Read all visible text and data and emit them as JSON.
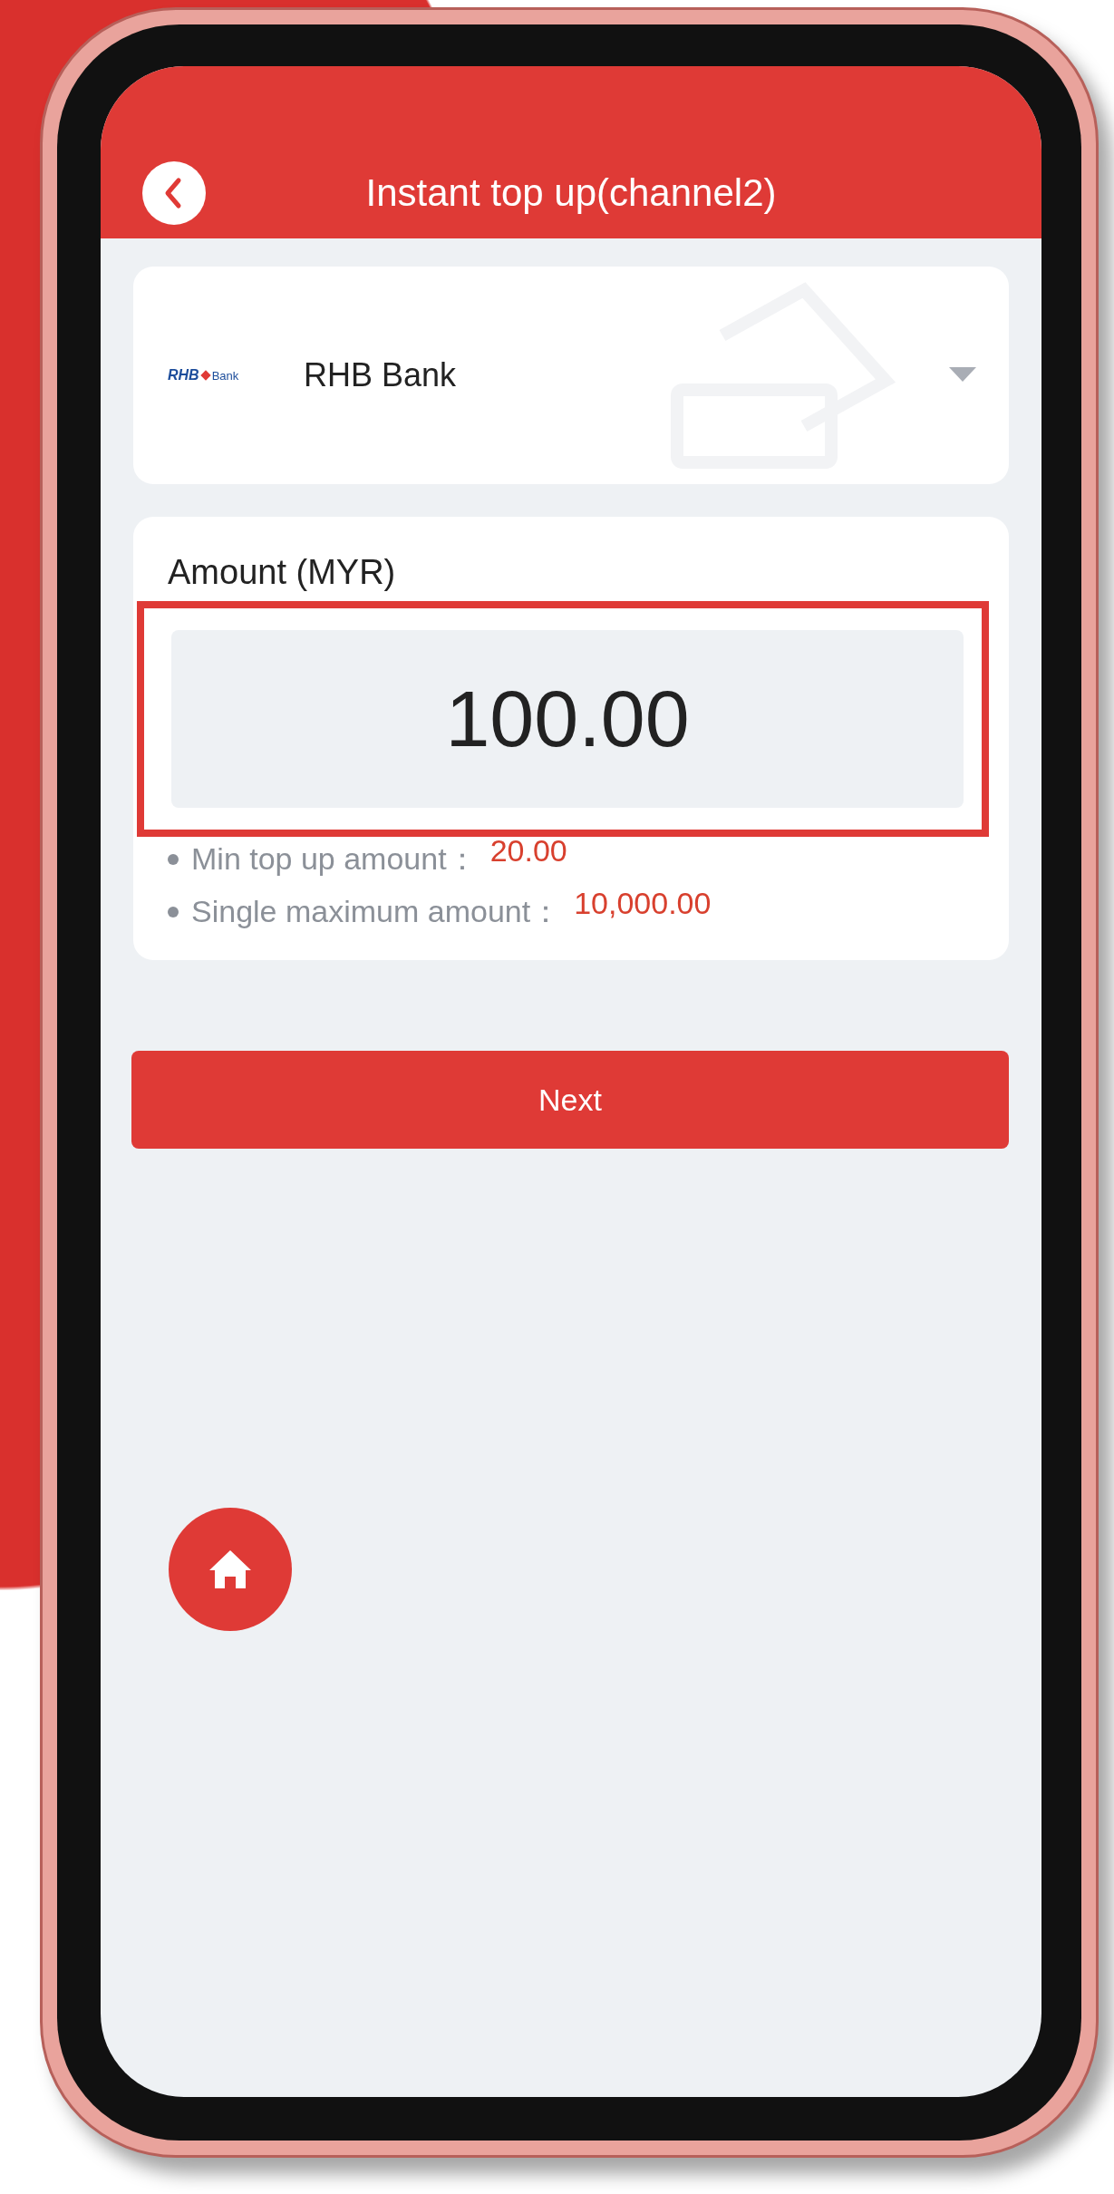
{
  "header": {
    "title": "Instant top up(channel2)"
  },
  "bank_selector": {
    "logo": {
      "brand": "RHB",
      "suffix": "Bank"
    },
    "name": "RHB Bank"
  },
  "amount": {
    "label": "Amount (MYR)",
    "value": "100.00",
    "highlighted": true
  },
  "limits": [
    {
      "label": "Min top up amount：",
      "value": "20.00"
    },
    {
      "label": "Single maximum amount：",
      "value": "10,000.00"
    }
  ],
  "next_button": "Next"
}
